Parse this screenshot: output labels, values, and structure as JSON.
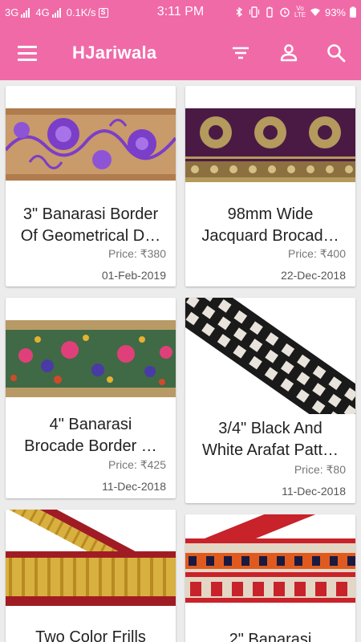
{
  "status_bar": {
    "network1": "3G",
    "network2": "4G",
    "speed": "0.1K/s",
    "s_badge": "S",
    "time": "3:11 PM",
    "volte": "Vo LTE",
    "battery": "93%"
  },
  "app_bar": {
    "title": "HJariwala",
    "menu_icon": "hamburger-menu-icon",
    "filter_icon": "filter-icon",
    "account_icon": "account-icon",
    "search_icon": "search-icon"
  },
  "products": [
    {
      "title_line1": "3\" Banarasi Border",
      "title_line2": "Of Geometrical D…",
      "price": "Price: ₹380",
      "date": "01-Feb-2019"
    },
    {
      "title_line1": "98mm Wide",
      "title_line2": "Jacquard Brocad…",
      "price": "Price: ₹400",
      "date": "22-Dec-2018"
    },
    {
      "title_line1": "4\" Banarasi",
      "title_line2": "Brocade Border …",
      "price": "Price: ₹425",
      "date": "11-Dec-2018"
    },
    {
      "title_line1": "3/4\" Black And",
      "title_line2": "White Arafat Patt…",
      "price": "Price: ₹80",
      "date": "11-Dec-2018"
    },
    {
      "title_line1": "Two Color Frills",
      "title_line2": "",
      "price": "",
      "date": ""
    },
    {
      "title_line1": "2\" Banarasi",
      "title_line2": "",
      "price": "",
      "date": ""
    }
  ]
}
